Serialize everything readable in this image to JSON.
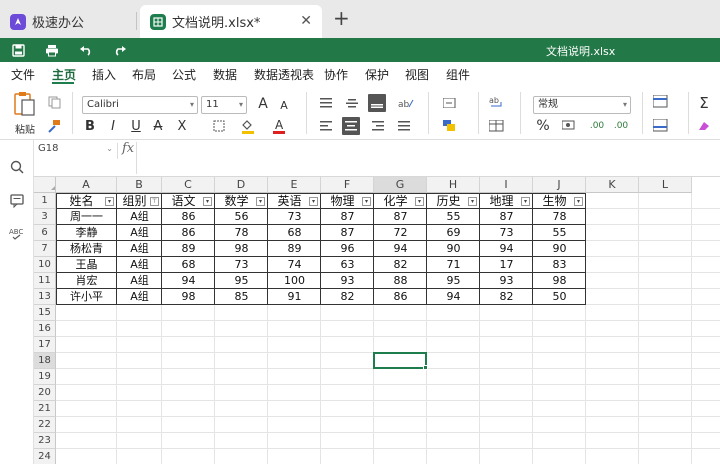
{
  "tabs": [
    {
      "label": "极速办公"
    },
    {
      "label": "文档说明.xlsx*"
    }
  ],
  "quickbar": {
    "doc_title": "文档说明.xlsx"
  },
  "menu": [
    "文件",
    "主页",
    "插入",
    "布局",
    "公式",
    "数据",
    "数据透视表",
    "协作",
    "保护",
    "视图",
    "组件"
  ],
  "ribbon": {
    "paste_label": "粘贴",
    "font_name": "Calibri",
    "font_size": "11",
    "number_format": "常规",
    "bold": "B",
    "italic": "I",
    "underline": "U",
    "strike": "A",
    "subscript": "X",
    "grow_font": "A",
    "shrink_font": "A",
    "percent": "%",
    "sigma": "Σ",
    "inc_decimal": ".00",
    "dec_decimal": ".00"
  },
  "formula_bar": {
    "name_box": "G18",
    "fx": "fx",
    "formula": ""
  },
  "grid": {
    "columns": [
      "A",
      "B",
      "C",
      "D",
      "E",
      "F",
      "G",
      "H",
      "I",
      "J",
      "K",
      "L"
    ],
    "selected_column": "G",
    "rows": [
      "1",
      "3",
      "6",
      "7",
      "10",
      "11",
      "13",
      "15",
      "16",
      "17",
      "18",
      "19",
      "20",
      "21",
      "22",
      "23",
      "24"
    ],
    "selected_row": "18",
    "headers": [
      "姓名",
      "组别",
      "语文",
      "数学",
      "英语",
      "物理",
      "化学",
      "历史",
      "地理",
      "生物"
    ],
    "data": [
      [
        "周一一",
        "A组",
        "86",
        "56",
        "73",
        "87",
        "87",
        "55",
        "87",
        "78"
      ],
      [
        "李静",
        "A组",
        "86",
        "78",
        "68",
        "87",
        "72",
        "69",
        "73",
        "55"
      ],
      [
        "杨松青",
        "A组",
        "89",
        "98",
        "89",
        "96",
        "94",
        "90",
        "94",
        "90"
      ],
      [
        "王晶",
        "A组",
        "68",
        "73",
        "74",
        "63",
        "82",
        "71",
        "17",
        "83"
      ],
      [
        "肖宏",
        "A组",
        "94",
        "95",
        "100",
        "93",
        "88",
        "95",
        "93",
        "98"
      ],
      [
        "许小平",
        "A组",
        "98",
        "85",
        "91",
        "82",
        "86",
        "94",
        "82",
        "50"
      ]
    ]
  },
  "colors": {
    "brand_green": "#237847",
    "selection": "#1e7d4d"
  }
}
